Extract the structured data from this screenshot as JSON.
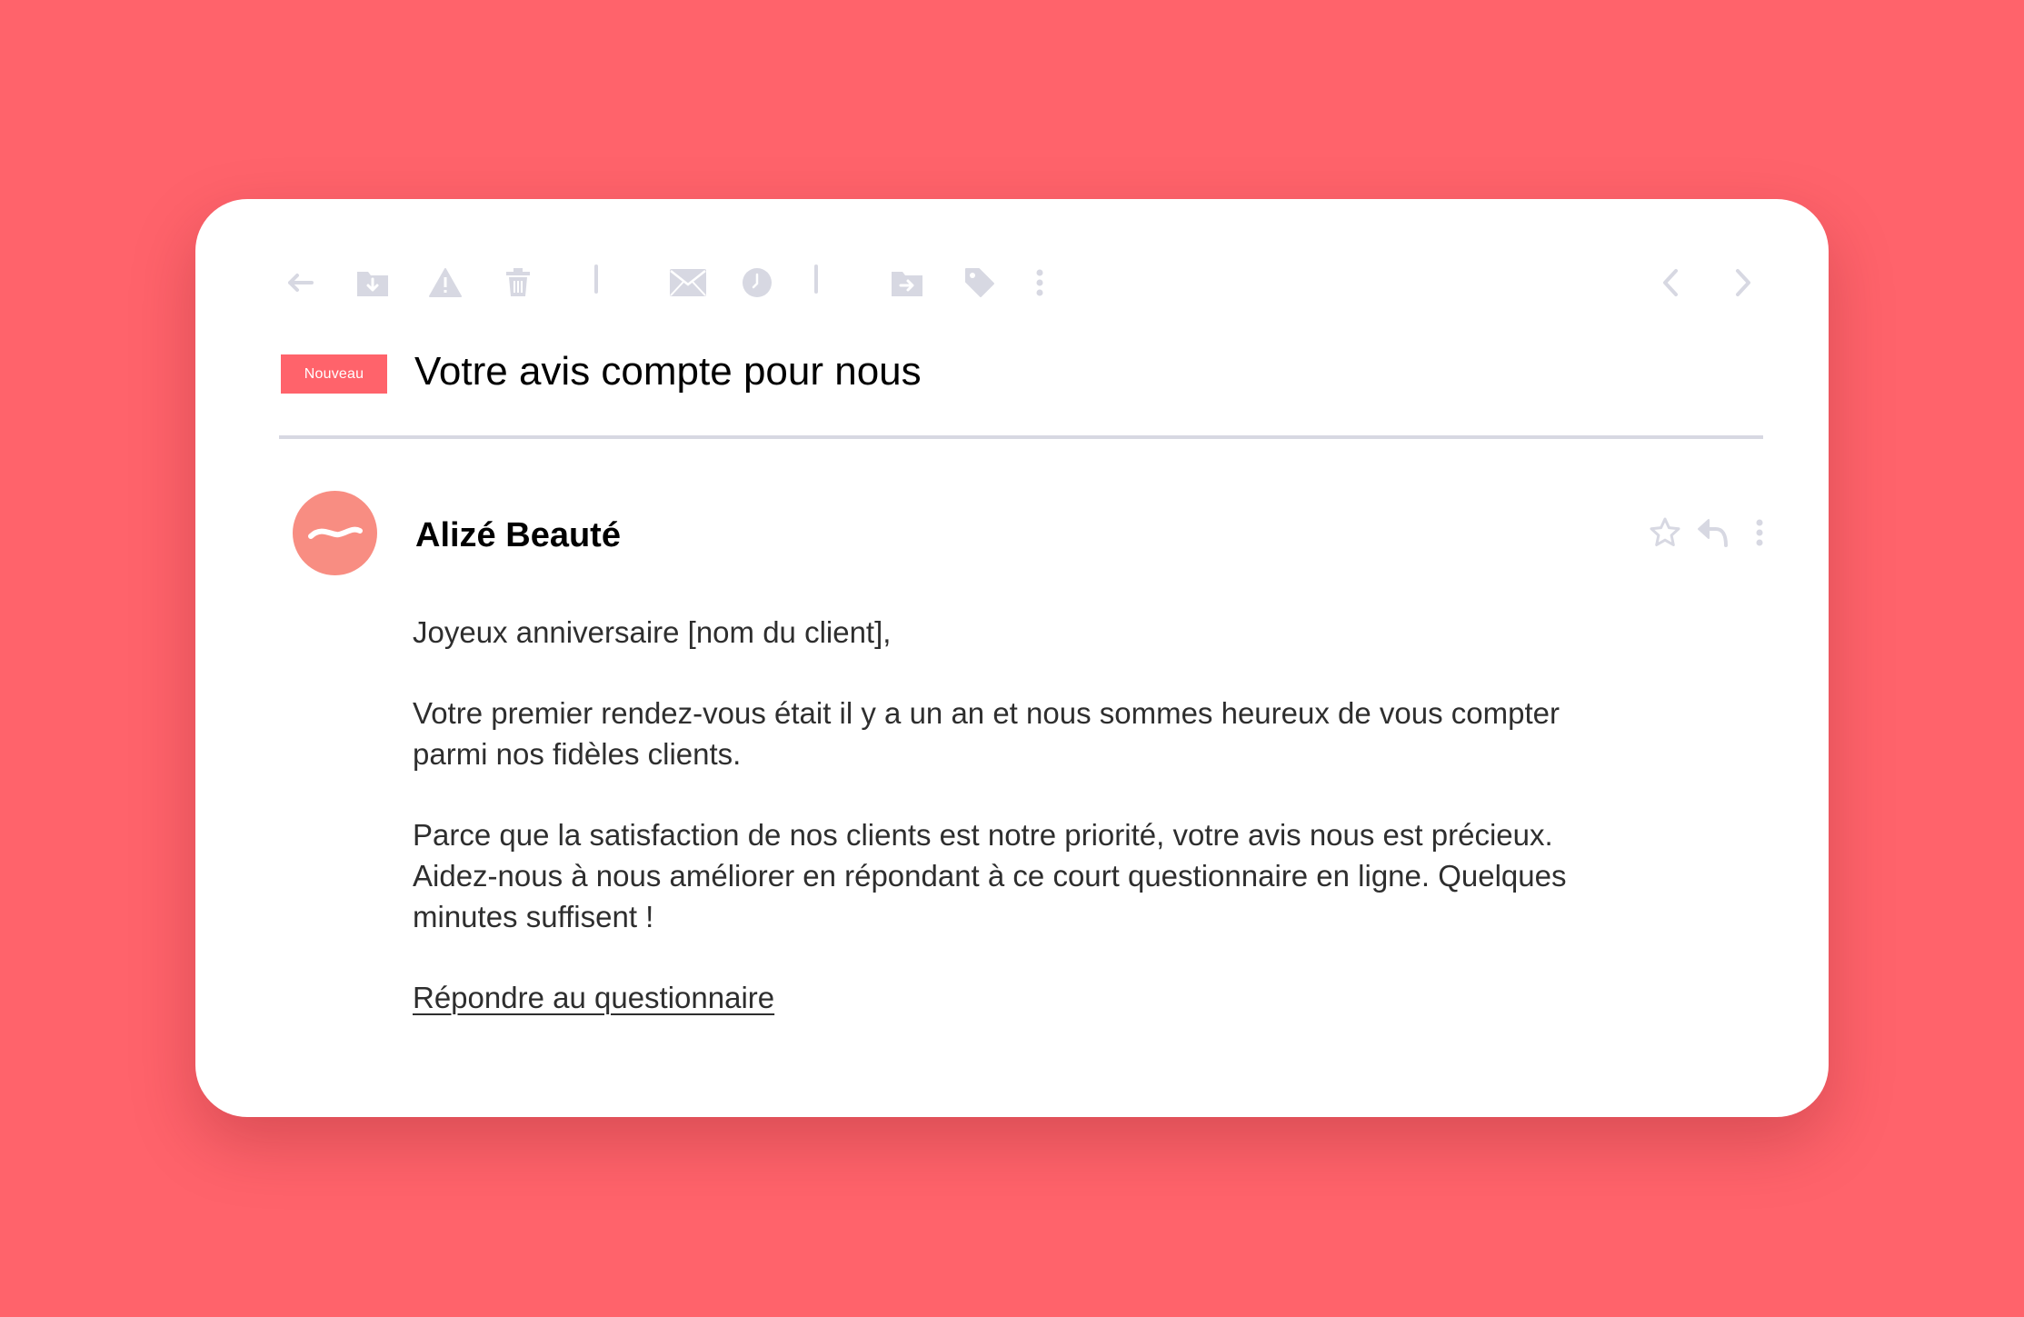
{
  "colors": {
    "background": "#ff636b",
    "card": "#ffffff",
    "badge": "#ff636b",
    "avatar": "#f88d82",
    "icon": "#d7d8e2",
    "text": "#2e2e2e"
  },
  "toolbar": {
    "icons": [
      "back-arrow-icon",
      "archive-icon",
      "spam-warning-icon",
      "trash-icon",
      "mark-unread-envelope-icon",
      "snooze-clock-icon",
      "move-to-folder-icon",
      "label-tag-icon",
      "more-options-icon",
      "previous-chevron-icon",
      "next-chevron-icon"
    ]
  },
  "email": {
    "badge": "Nouveau",
    "subject": "Votre avis compte pour nous",
    "sender": "Alizé Beauté",
    "message_actions": [
      "star-icon",
      "reply-icon",
      "more-options-icon"
    ],
    "greeting": "Joyeux anniversaire [nom du client],",
    "paragraph_1_line_1": "Votre premier rendez-vous était il y a un an et nous sommes heureux de vous compter",
    "paragraph_1_line_2": "parmi nos fidèles clients.",
    "paragraph_2_line_1": "Parce que la satisfaction de nos clients est notre priorité, votre avis nous est précieux.",
    "paragraph_2_line_2": "Aidez-nous à nous améliorer en répondant à ce court questionnaire en ligne. Quelques",
    "paragraph_2_line_3": "minutes suffisent !",
    "cta_link": "Répondre au questionnaire"
  }
}
